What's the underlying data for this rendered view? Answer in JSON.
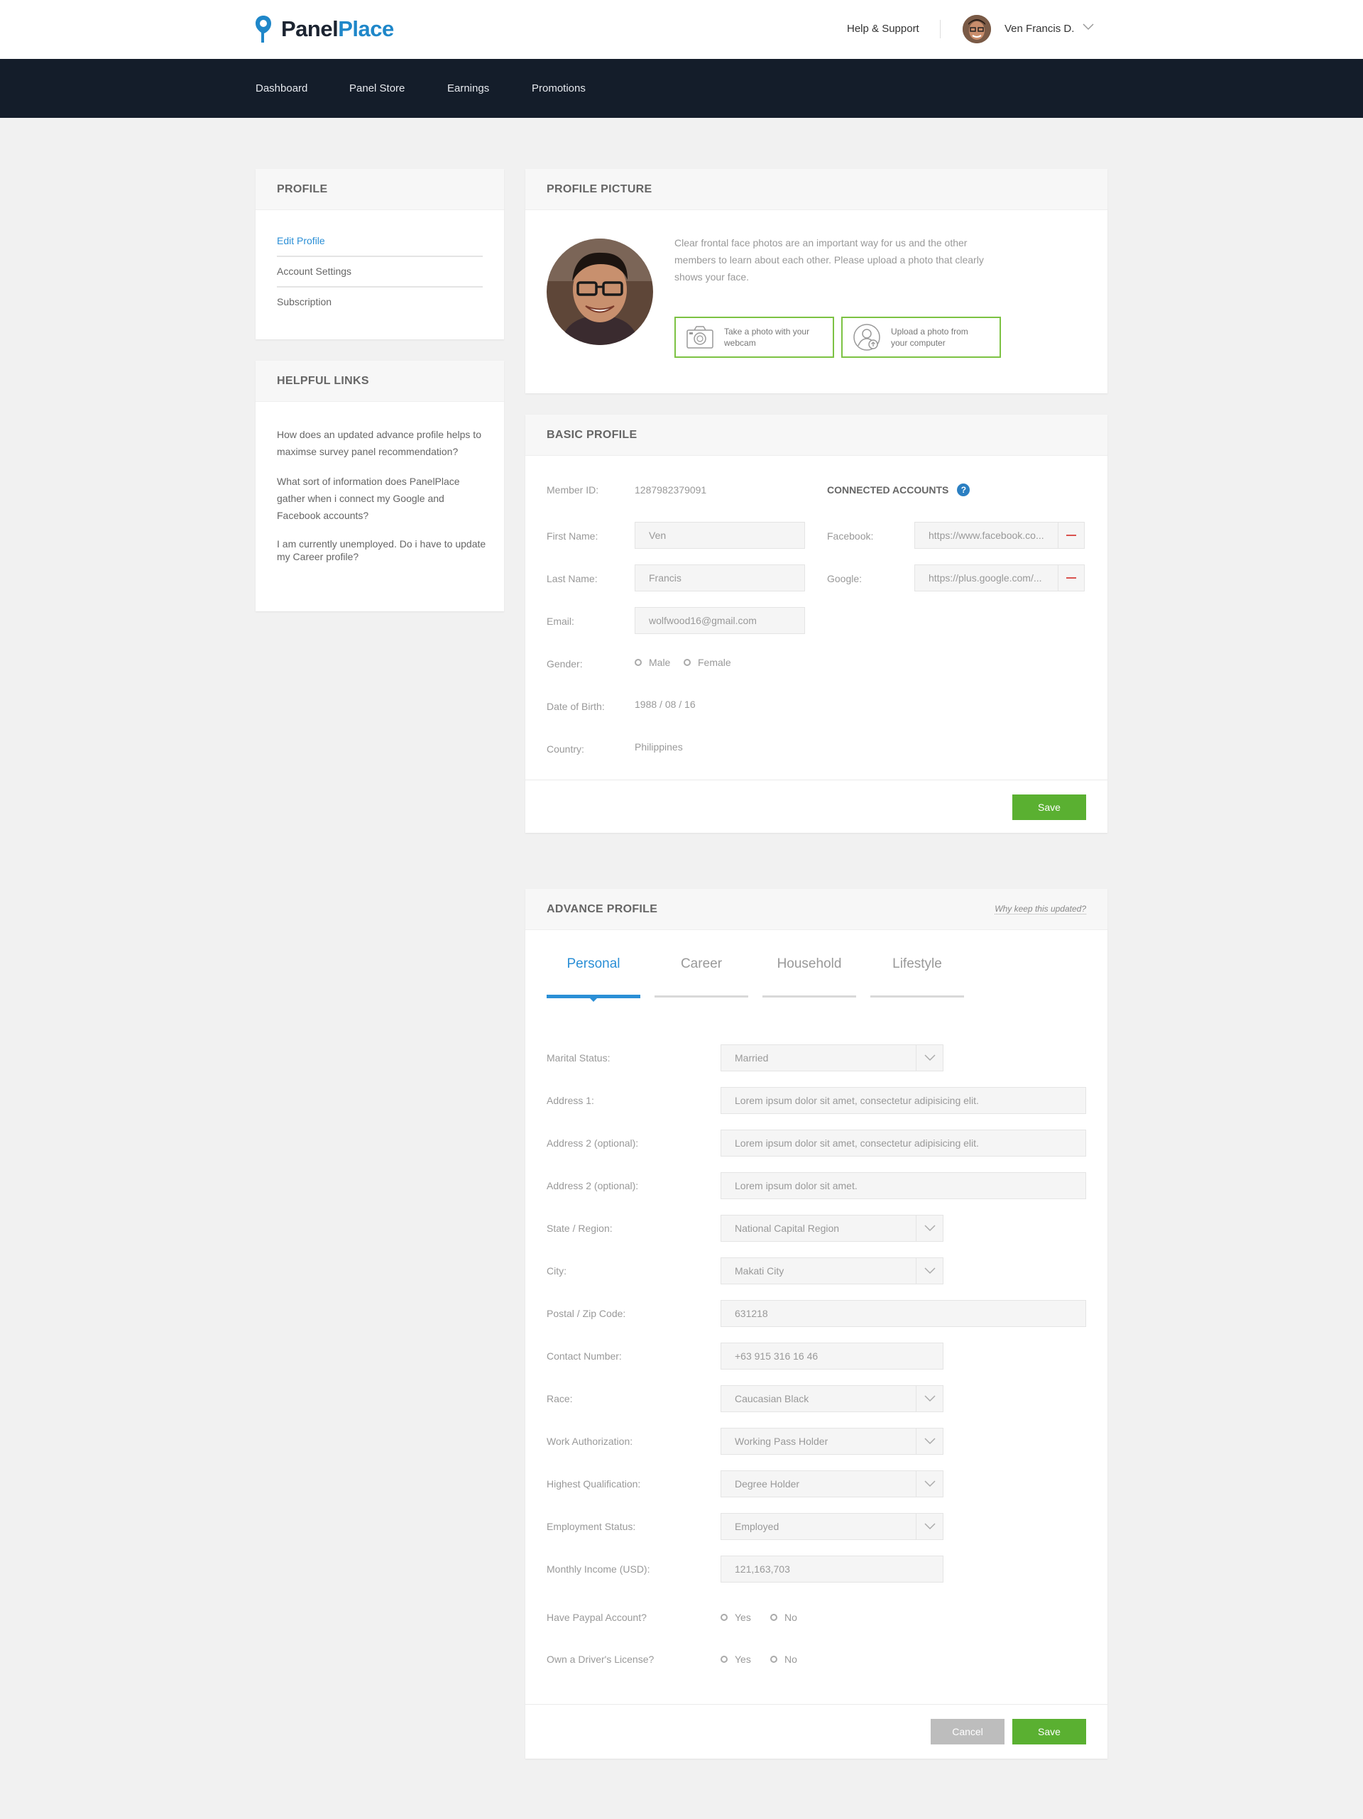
{
  "brand": {
    "name_part1": "Panel",
    "name_part2": "Place",
    "accent": "#1f87c9",
    "nav_bg": "#141d2a",
    "save_green": "#5ab031",
    "frame_green": "#7cc243"
  },
  "header": {
    "help_label": "Help & Support",
    "user_name": "Ven Francis D."
  },
  "nav": {
    "items": [
      "Dashboard",
      "Panel Store",
      "Earnings",
      "Promotions"
    ]
  },
  "sidebar": {
    "profile_title": "PROFILE",
    "links": [
      "Edit Profile",
      "Account Settings",
      "Subscription"
    ],
    "active_link": "Edit Profile",
    "helpful_title": "HELPFUL LINKS",
    "questions": [
      "How does an updated advance profile helps to maximse survey panel recommendation?",
      "What sort of information does PanelPlace gather when i connect my Google and Facebook accounts?",
      "I am currently unemployed. Do i have to update my Career profile?"
    ]
  },
  "profile_picture": {
    "title": "PROFILE PICTURE",
    "description": "Clear frontal face photos are an important way for us and the other members to learn about each other. Please upload a photo that clearly shows your face.",
    "webcam_label": "Take a photo with your webcam",
    "upload_label": "Upload a photo from your computer"
  },
  "basic_profile": {
    "title": "BASIC PROFILE",
    "member_id_label": "Member ID:",
    "member_id": "1287982379091",
    "first_name_label": "First Name:",
    "first_name": "Ven",
    "last_name_label": "Last Name:",
    "last_name": "Francis",
    "email_label": "Email:",
    "email": "wolfwood16@gmail.com",
    "gender_label": "Gender:",
    "gender_options": [
      "Male",
      "Female"
    ],
    "dob_label": "Date of Birth:",
    "dob": "1988 / 08 / 16",
    "country_label": "Country:",
    "country": "Philippines",
    "connected_title": "CONNECTED ACCOUNTS",
    "facebook_label": "Facebook:",
    "facebook_url": "https://www.facebook.co...",
    "google_label": "Google:",
    "google_url": "https://plus.google.com/...",
    "save_label": "Save"
  },
  "advance_profile": {
    "title": "ADVANCE PROFILE",
    "why_link": "Why keep this updated?",
    "tabs": [
      "Personal",
      "Career",
      "Household",
      "Lifestyle"
    ],
    "active_tab": "Personal",
    "fields": {
      "marital_label": "Marital Status:",
      "marital": "Married",
      "address1_label": "Address 1:",
      "address1": "Lorem ipsum dolor sit amet, consectetur adipisicing elit.",
      "address2_label": "Address 2 (optional):",
      "address2": "Lorem ipsum dolor sit amet, consectetur adipisicing elit.",
      "address3_label": "Address 2 (optional):",
      "address3": "Lorem ipsum dolor sit amet.",
      "state_label": "State / Region:",
      "state": "National Capital Region",
      "city_label": "City:",
      "city": "Makati City",
      "postal_label": "Postal / Zip Code:",
      "postal": "631218",
      "contact_label": "Contact Number:",
      "contact": "+63 915 316 16 46",
      "race_label": "Race:",
      "race": "Caucasian Black",
      "work_label": "Work Authorization:",
      "work": "Working Pass Holder",
      "qualification_label": "Highest Qualification:",
      "qualification": "Degree Holder",
      "employment_label": "Employment Status:",
      "employment": "Employed",
      "income_label": "Monthly Income (USD):",
      "income": "121,163,703",
      "paypal_label": "Have Paypal Account?",
      "license_label": "Own a Driver's License?",
      "yes": "Yes",
      "no": "No"
    },
    "cancel_label": "Cancel",
    "save_label": "Save"
  }
}
